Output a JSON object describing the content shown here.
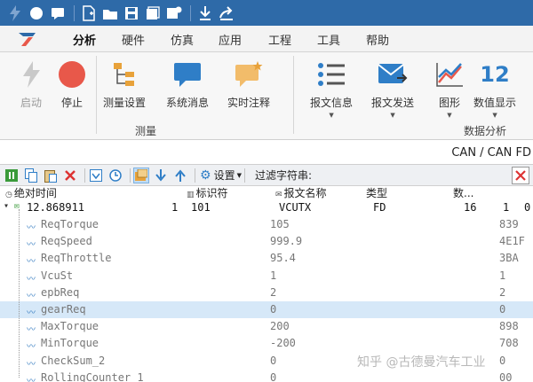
{
  "ribbon_tabs": [
    "分析",
    "硬件",
    "仿真",
    "应用",
    "工程",
    "工具",
    "帮助"
  ],
  "ribbon": {
    "measure_buttons": [
      {
        "label": "启动",
        "icon": "lightning-icon",
        "enabled": false
      },
      {
        "label": "停止",
        "icon": "stop-circle-icon",
        "enabled": true
      },
      {
        "label": "测量设置",
        "icon": "measurement-setup-icon",
        "enabled": true
      },
      {
        "label": "系统消息",
        "icon": "chat-bubble-icon",
        "enabled": true
      },
      {
        "label": "实时注释",
        "icon": "comment-star-icon",
        "enabled": true
      }
    ],
    "measure_group_label": "测量",
    "analysis_buttons": [
      {
        "label": "报文信息",
        "icon": "list-icon"
      },
      {
        "label": "报文发送",
        "icon": "envelope-send-icon"
      },
      {
        "label": "图形",
        "icon": "line-graph-icon"
      },
      {
        "label": "数值显示",
        "icon": "numeric-display-icon"
      }
    ],
    "analysis_icon_text": "12",
    "analysis_group_label": "数据分析"
  },
  "pane_title": "CAN / CAN FD",
  "toolbar": {
    "settings_label": "设置",
    "filter_label": "过滤字符串:",
    "filter_value": ""
  },
  "grid": {
    "headers": [
      "绝对时间",
      "标识符",
      "报文名称",
      "类型",
      "数..."
    ],
    "message": {
      "time": "12.868911",
      "channel": "1",
      "id": "101",
      "name": "VCUTX",
      "type": "FD",
      "dlc": "16",
      "c7": "1",
      "c8": "0"
    },
    "signals": [
      {
        "name": "ReqTorque",
        "value": "105",
        "raw": "839"
      },
      {
        "name": "ReqSpeed",
        "value": "999.9",
        "raw": "4E1F"
      },
      {
        "name": "ReqThrottle",
        "value": "95.4",
        "raw": "3BA"
      },
      {
        "name": "VcuSt",
        "value": "1",
        "raw": "1"
      },
      {
        "name": "epbReq",
        "value": "2",
        "raw": "2"
      },
      {
        "name": "gearReq",
        "value": "0",
        "raw": "0"
      },
      {
        "name": "MaxTorque",
        "value": "200",
        "raw": "898"
      },
      {
        "name": "MinTorque",
        "value": "-200",
        "raw": "708"
      },
      {
        "name": "CheckSum_2",
        "value": "0",
        "raw": "0"
      },
      {
        "name": "RollingCounter_1",
        "value": "0",
        "raw": "00"
      }
    ],
    "selected_index": 5
  },
  "watermark": "知乎 @古德曼汽车工业",
  "colors": {
    "accent": "#2e6aa8",
    "selected_row": "#d6e8f8",
    "stop": "#e8584a"
  }
}
